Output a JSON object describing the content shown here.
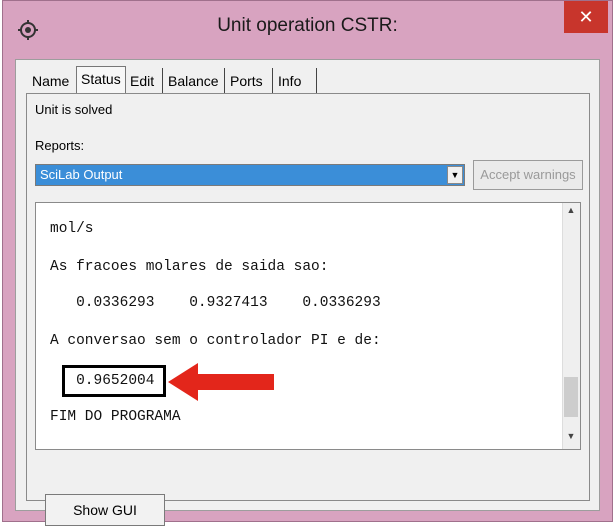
{
  "window": {
    "title": "Unit operation CSTR:",
    "close_glyph": "✕",
    "icon": "gear-icon"
  },
  "tabs": [
    {
      "label": "Name"
    },
    {
      "label": "Status"
    },
    {
      "label": "Edit"
    },
    {
      "label": "Balance"
    },
    {
      "label": "Ports"
    },
    {
      "label": "Info"
    }
  ],
  "status_text": "Unit is solved",
  "reports": {
    "label": "Reports:",
    "selected": "SciLab Output",
    "accept_label": "Accept warnings"
  },
  "output_lines": [
    "mol/s",
    "As fracoes molares de saida sao:",
    "   0.0336293    0.9327413    0.0336293",
    "A conversao sem o controlador PI e de:",
    "   0.9652004",
    "FIM DO PROGRAMA"
  ],
  "show_gui_label": "Show GUI",
  "colors": {
    "selection": "#3b8ed8",
    "highlight_arrow": "#e3261b",
    "close": "#c8352c"
  }
}
